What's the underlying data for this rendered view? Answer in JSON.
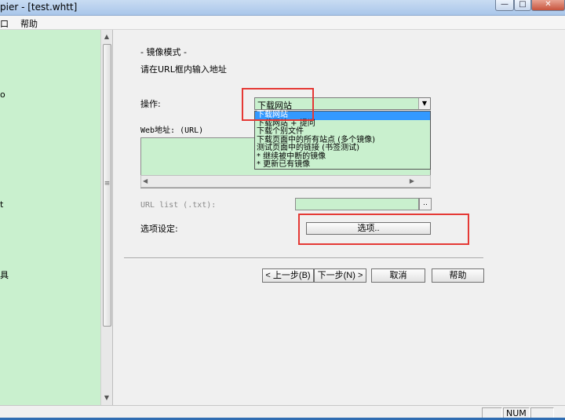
{
  "window": {
    "title": "pier - [test.whtt]",
    "controls": {
      "minimize": "—",
      "maximize": "□",
      "close": "✕"
    }
  },
  "menu": {
    "items": [
      "口",
      "帮助"
    ]
  },
  "left_panel": {
    "fragments": [
      "o",
      "t",
      "具"
    ]
  },
  "main": {
    "section_title": "- 镜像模式 -",
    "instruction": "请在URL框内输入地址",
    "action_label": "操作:",
    "action_selected": "下载网站",
    "action_options": [
      "下载网站",
      "下载网站 + 提问",
      "下载个别文件",
      "下载页面中的所有站点 (多个镜像)",
      "测试页面中的链接 (书签测试)",
      "* 继续被中断的镜像",
      "* 更新已有镜像"
    ],
    "web_address_label": "Web地址: (URL)",
    "url_list_label": "URL list (.txt):",
    "browse_label": "..",
    "options_label": "选项设定:",
    "options_button": "选项..",
    "buttons": {
      "back": "< 上一步(B)",
      "next": "下一步(N) >",
      "cancel": "取消",
      "help": "帮助"
    }
  },
  "statusbar": {
    "cells": [
      "",
      "NUM",
      ""
    ]
  },
  "colors": {
    "field_bg": "#c9f0ce",
    "highlight": "#3399ff",
    "annotation": "#e53935"
  }
}
